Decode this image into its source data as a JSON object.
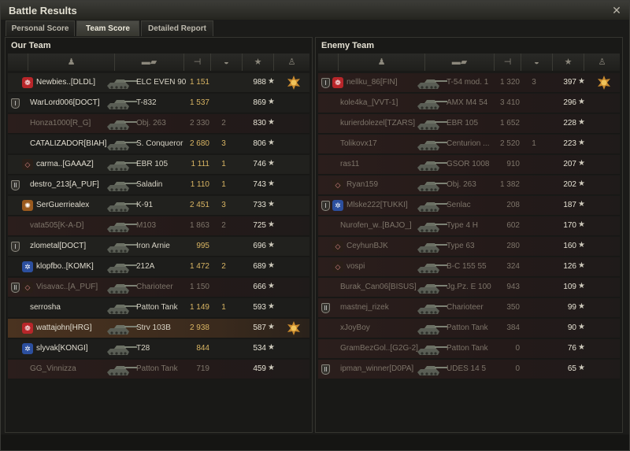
{
  "window": {
    "title": "Battle Results"
  },
  "tabs": [
    {
      "label": "Personal Score",
      "active": false
    },
    {
      "label": "Team Score",
      "active": true
    },
    {
      "label": "Detailed Report",
      "active": false
    }
  ],
  "columns": [
    "player-icon",
    "vehicle-icon",
    "damage-icon",
    "kills-icon",
    "experience-icon",
    "medal-icon"
  ],
  "our_team": {
    "title": "Our Team",
    "rows": [
      {
        "name": "Newbies..[DLDL]",
        "tank": "ELC EVEN 90",
        "damage": "1 151",
        "kills": "",
        "xp": "988",
        "dead": false,
        "me": false,
        "rank": "",
        "clan": "red",
        "medal": true
      },
      {
        "name": "WarLord006[DOCT]",
        "tank": "T-832",
        "damage": "1 537",
        "kills": "",
        "xp": "869",
        "dead": false,
        "me": false,
        "rank": "I",
        "clan": "",
        "medal": false
      },
      {
        "name": "Honza1000[R_G]",
        "tank": "Obj. 263",
        "damage": "2 330",
        "kills": "2",
        "xp": "830",
        "dead": true,
        "me": false,
        "rank": "",
        "clan": "",
        "medal": false
      },
      {
        "name": "CATALIZADOR[BIAH]",
        "tank": "S. Conqueror",
        "damage": "2 680",
        "kills": "3",
        "xp": "806",
        "dead": false,
        "me": false,
        "rank": "",
        "clan": "",
        "medal": false
      },
      {
        "name": "carma..[GAAAZ]",
        "tank": "EBR 105",
        "damage": "1 111",
        "kills": "1",
        "xp": "746",
        "dead": false,
        "me": false,
        "rank": "",
        "clan": "diamond",
        "medal": false
      },
      {
        "name": "destro_213[A_PUF]",
        "tank": "Saladin",
        "damage": "1 110",
        "kills": "1",
        "xp": "743",
        "dead": false,
        "me": false,
        "rank": "II",
        "clan": "",
        "medal": false
      },
      {
        "name": "SerGuerriealex",
        "tank": "K-91",
        "damage": "2 451",
        "kills": "3",
        "xp": "733",
        "dead": false,
        "me": false,
        "rank": "",
        "clan": "orange",
        "medal": false
      },
      {
        "name": "vata505[K-A-D]",
        "tank": "M103",
        "damage": "1 863",
        "kills": "2",
        "xp": "725",
        "dead": true,
        "me": false,
        "rank": "",
        "clan": "",
        "medal": false
      },
      {
        "name": "zlometal[DOCT]",
        "tank": "Iron Arnie",
        "damage": "995",
        "kills": "",
        "xp": "696",
        "dead": false,
        "me": false,
        "rank": "I",
        "clan": "",
        "medal": false
      },
      {
        "name": "klopfbo..[KOMK]",
        "tank": "212A",
        "damage": "1 472",
        "kills": "2",
        "xp": "689",
        "dead": false,
        "me": false,
        "rank": "",
        "clan": "blue",
        "medal": false
      },
      {
        "name": "Visavac..[A_PUF]",
        "tank": "Charioteer",
        "damage": "1 150",
        "kills": "",
        "xp": "666",
        "dead": true,
        "me": false,
        "rank": "II",
        "clan": "diamond",
        "medal": false
      },
      {
        "name": "serrosha",
        "tank": "Patton Tank",
        "damage": "1 149",
        "kills": "1",
        "xp": "593",
        "dead": false,
        "me": false,
        "rank": "",
        "clan": "",
        "medal": false
      },
      {
        "name": "wattajohn[HRG]",
        "tank": "Strv 103B",
        "damage": "2 938",
        "kills": "",
        "xp": "587",
        "dead": false,
        "me": true,
        "rank": "",
        "clan": "red",
        "medal": true
      },
      {
        "name": "slyvak[KONGI]",
        "tank": "T28",
        "damage": "844",
        "kills": "",
        "xp": "534",
        "dead": false,
        "me": false,
        "rank": "",
        "clan": "blue",
        "medal": false
      },
      {
        "name": "GG_Vinnizza",
        "tank": "Patton Tank",
        "damage": "719",
        "kills": "",
        "xp": "459",
        "dead": true,
        "me": false,
        "rank": "",
        "clan": "",
        "medal": false
      }
    ]
  },
  "enemy_team": {
    "title": "Enemy Team",
    "rows": [
      {
        "name": "nellku_86[FIN]",
        "tank": "T-54 mod. 1",
        "damage": "1 320",
        "kills": "3",
        "xp": "397",
        "dead": true,
        "me": false,
        "rank": "I",
        "clan": "red",
        "medal": true
      },
      {
        "name": "kole4ka_[VVT-1]",
        "tank": "AMX M4 54",
        "damage": "3 410",
        "kills": "",
        "xp": "296",
        "dead": true,
        "me": false,
        "rank": "",
        "clan": "",
        "medal": false
      },
      {
        "name": "kurierdolezel[TZARS]",
        "tank": "EBR 105",
        "damage": "1 652",
        "kills": "",
        "xp": "228",
        "dead": true,
        "me": false,
        "rank": "",
        "clan": "",
        "medal": false
      },
      {
        "name": "Tolikovx17",
        "tank": "Centurion ...",
        "damage": "2 520",
        "kills": "1",
        "xp": "223",
        "dead": true,
        "me": false,
        "rank": "",
        "clan": "",
        "medal": false
      },
      {
        "name": "ras11",
        "tank": "GSOR 1008",
        "damage": "910",
        "kills": "",
        "xp": "207",
        "dead": true,
        "me": false,
        "rank": "",
        "clan": "",
        "medal": false
      },
      {
        "name": "Ryan159",
        "tank": "Obj. 263",
        "damage": "1 382",
        "kills": "",
        "xp": "202",
        "dead": true,
        "me": false,
        "rank": "",
        "clan": "diamond",
        "medal": false
      },
      {
        "name": "Mlske222[TUKKI]",
        "tank": "Senlac",
        "damage": "208",
        "kills": "",
        "xp": "187",
        "dead": true,
        "me": false,
        "rank": "I",
        "clan": "blue",
        "medal": false
      },
      {
        "name": "Nurofen_w..[BAJO_]",
        "tank": "Type 4 H",
        "damage": "602",
        "kills": "",
        "xp": "170",
        "dead": true,
        "me": false,
        "rank": "",
        "clan": "",
        "medal": false
      },
      {
        "name": "CeyhunBJK",
        "tank": "Type 63",
        "damage": "280",
        "kills": "",
        "xp": "160",
        "dead": true,
        "me": false,
        "rank": "",
        "clan": "diamond",
        "medal": false
      },
      {
        "name": "vospi",
        "tank": "B-C 155 55",
        "damage": "324",
        "kills": "",
        "xp": "126",
        "dead": true,
        "me": false,
        "rank": "",
        "clan": "diamond",
        "medal": false
      },
      {
        "name": "Burak_Can06[BISUS]",
        "tank": "Jg.Pz. E 100",
        "damage": "943",
        "kills": "",
        "xp": "109",
        "dead": true,
        "me": false,
        "rank": "",
        "clan": "",
        "medal": false
      },
      {
        "name": "mastnej_rizek",
        "tank": "Charioteer",
        "damage": "350",
        "kills": "",
        "xp": "99",
        "dead": true,
        "me": false,
        "rank": "II",
        "clan": "",
        "medal": false
      },
      {
        "name": "xJoyBoy",
        "tank": "Patton Tank",
        "damage": "384",
        "kills": "",
        "xp": "90",
        "dead": true,
        "me": false,
        "rank": "",
        "clan": "",
        "medal": false
      },
      {
        "name": "GramBezGol..[G2G-2]",
        "tank": "Patton Tank",
        "damage": "0",
        "kills": "",
        "xp": "76",
        "dead": true,
        "me": false,
        "rank": "",
        "clan": "",
        "medal": false
      },
      {
        "name": "ipman_winner[D0PA]",
        "tank": "UDES 14 5",
        "damage": "0",
        "kills": "",
        "xp": "65",
        "dead": true,
        "me": false,
        "rank": "II",
        "clan": "",
        "medal": false
      }
    ]
  },
  "colors": {
    "accent": "#d9b563",
    "dead_row": "#2b1e1c",
    "player_row": "#4a3320"
  }
}
